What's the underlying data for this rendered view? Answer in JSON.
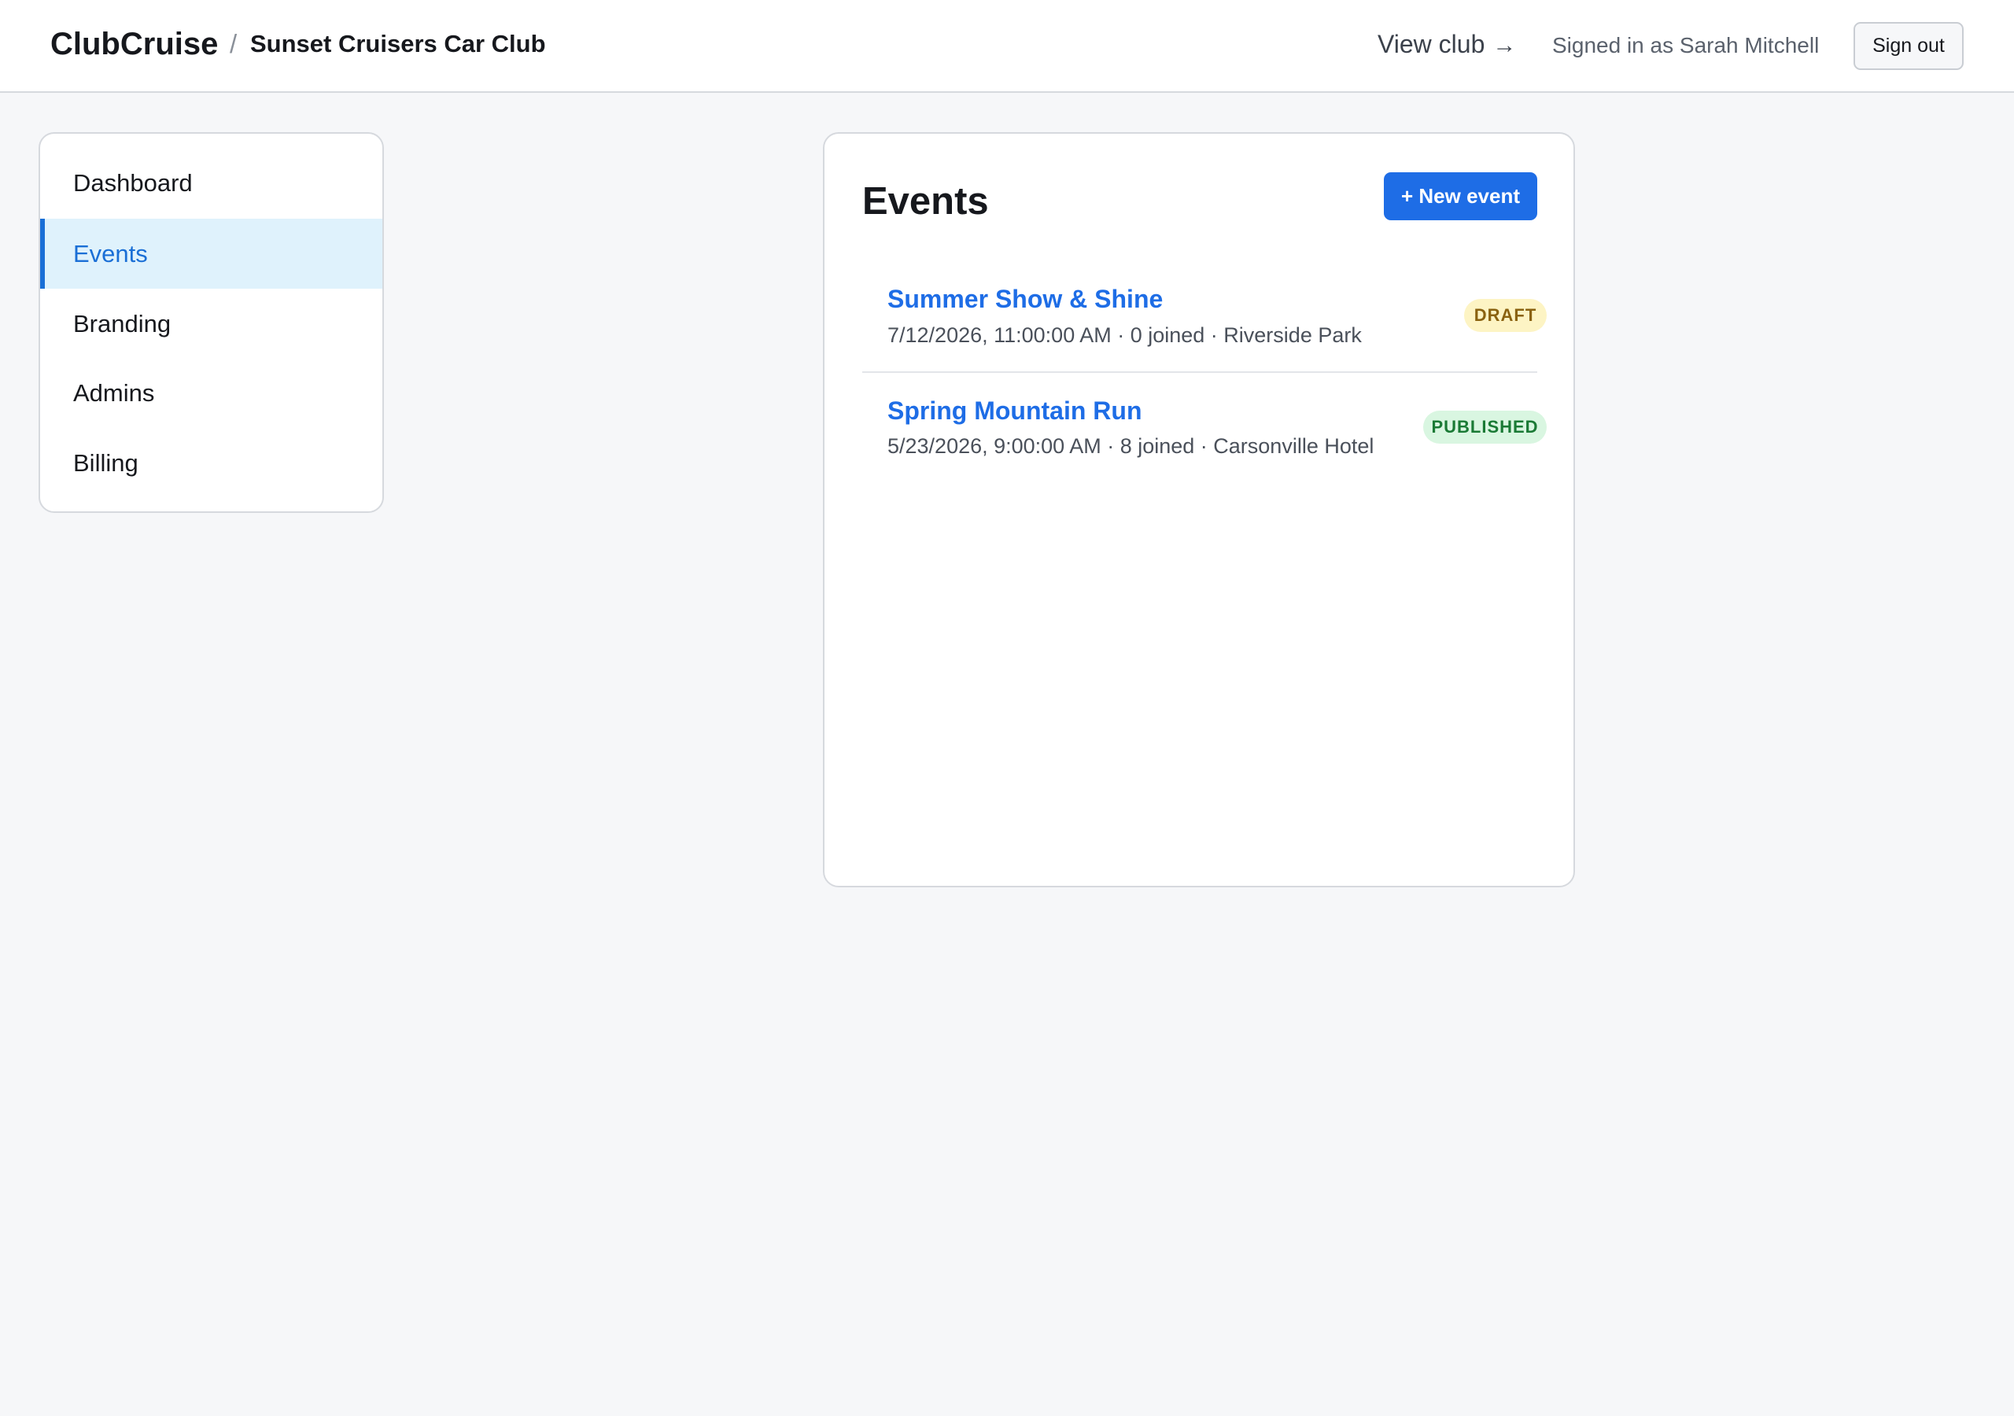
{
  "header": {
    "brand": "ClubCruise",
    "separator": "/",
    "club_name": "Sunset Cruisers Car Club",
    "view_club_label": "View club",
    "view_club_arrow": "→",
    "signed_in_text": "Signed in as Sarah Mitchell",
    "sign_out_label": "Sign out"
  },
  "sidebar": {
    "items": [
      {
        "label": "Dashboard",
        "active": false
      },
      {
        "label": "Events",
        "active": true
      },
      {
        "label": "Branding",
        "active": false
      },
      {
        "label": "Admins",
        "active": false
      },
      {
        "label": "Billing",
        "active": false
      }
    ]
  },
  "main": {
    "title": "Events",
    "new_event_label": "+ New event",
    "events": [
      {
        "title": "Summer Show & Shine",
        "meta": "7/12/2026, 11:00:00 AM · 0 joined · Riverside Park",
        "status": "DRAFT"
      },
      {
        "title": "Spring Mountain Run",
        "meta": "5/23/2026, 9:00:00 AM · 8 joined · Carsonville Hotel",
        "status": "PUBLISHED"
      }
    ]
  },
  "colors": {
    "accent": "#1e6de6",
    "active_nav_bg": "#dff2fc",
    "draft_badge_bg": "#fdf4c4",
    "published_badge_bg": "#d9f6e1"
  }
}
